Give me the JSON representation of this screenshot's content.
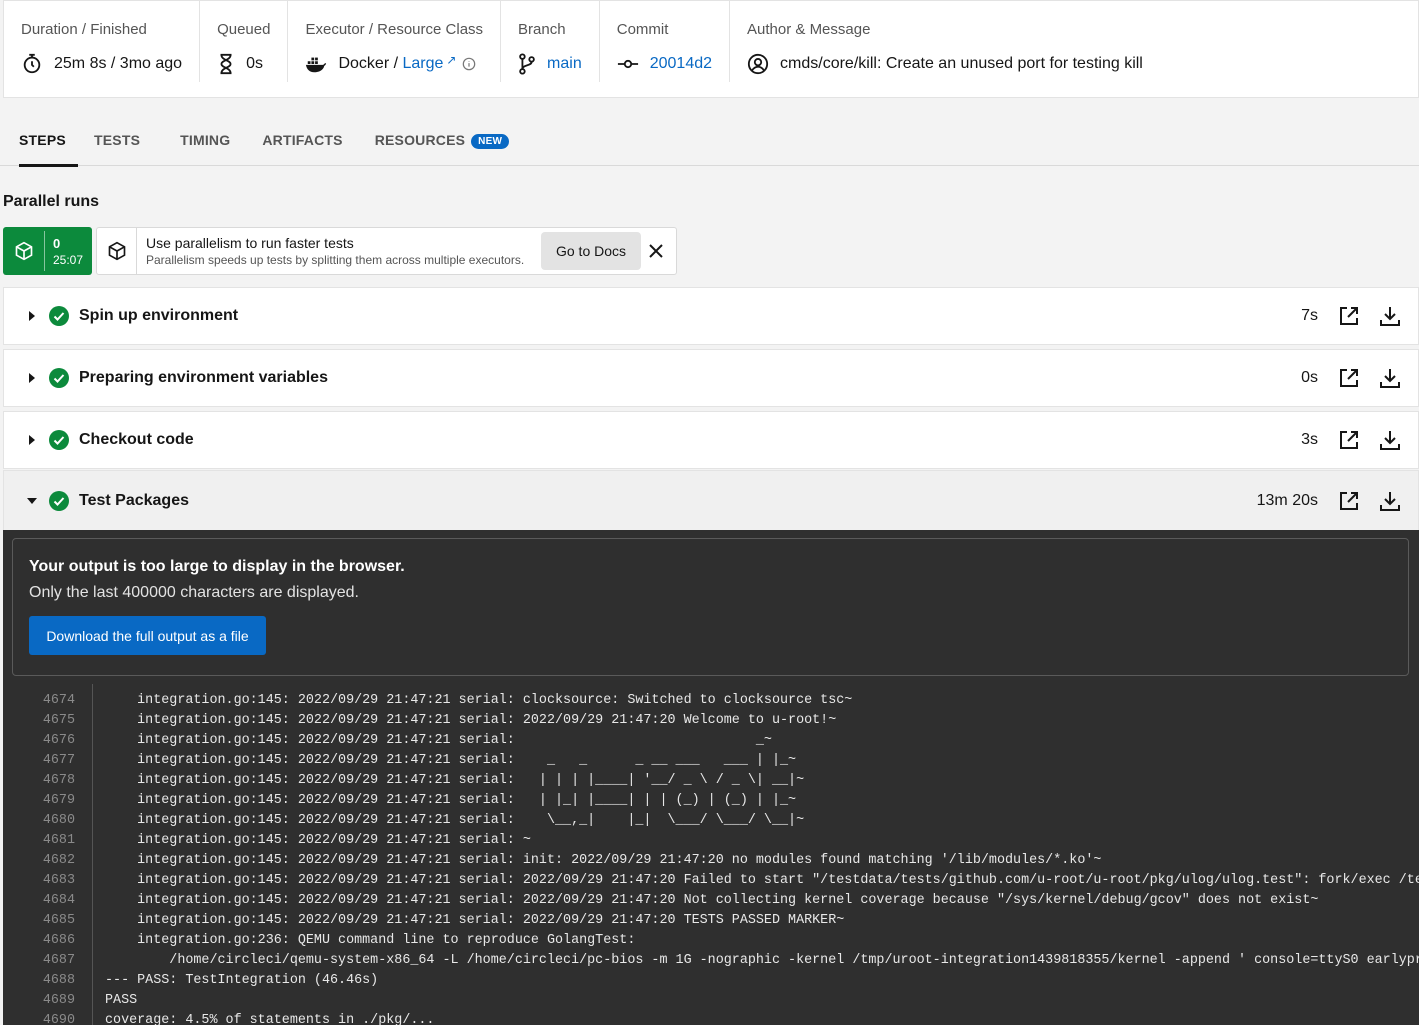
{
  "summary": {
    "duration": {
      "label": "Duration / Finished",
      "value": "25m 8s / 3mo ago"
    },
    "queued": {
      "label": "Queued",
      "value": "0s"
    },
    "executor": {
      "label": "Executor / Resource Class",
      "prefix": "Docker / ",
      "resource_class": "Large"
    },
    "branch": {
      "label": "Branch",
      "value": "main"
    },
    "commit": {
      "label": "Commit",
      "value": "20014d2"
    },
    "author": {
      "label": "Author & Message",
      "value": "cmds/core/kill: Create an unused port for testing kill"
    }
  },
  "tabs": [
    {
      "label": "STEPS",
      "active": true
    },
    {
      "label": "TESTS"
    },
    {
      "label": "TIMING"
    },
    {
      "label": "ARTIFACTS"
    },
    {
      "label": "RESOURCES",
      "badge": "NEW"
    }
  ],
  "parallel": {
    "title": "Parallel runs",
    "run_index": "0",
    "run_time": "25:07",
    "tip_title": "Use parallelism to run faster tests",
    "tip_sub": "Parallelism speeds up tests by splitting them across multiple executors.",
    "docs_label": "Go to Docs"
  },
  "steps": [
    {
      "name": "Spin up environment",
      "duration": "7s",
      "expanded": false
    },
    {
      "name": "Preparing environment variables",
      "duration": "0s",
      "expanded": false
    },
    {
      "name": "Checkout code",
      "duration": "3s",
      "expanded": false
    },
    {
      "name": "Test Packages",
      "duration": "13m 20s",
      "expanded": true
    }
  ],
  "output": {
    "warn_title": "Your output is too large to display in the browser.",
    "warn_sub": "Only the last 400000 characters are displayed.",
    "download_label": "Download the full output as a file",
    "lines": [
      {
        "n": "4674",
        "t": "    integration.go:145: 2022/09/29 21:47:21 serial: clocksource: Switched to clocksource tsc~"
      },
      {
        "n": "4675",
        "t": "    integration.go:145: 2022/09/29 21:47:21 serial: 2022/09/29 21:47:20 Welcome to u-root!~"
      },
      {
        "n": "4676",
        "t": "    integration.go:145: 2022/09/29 21:47:21 serial:                              _~"
      },
      {
        "n": "4677",
        "t": "    integration.go:145: 2022/09/29 21:47:21 serial:    _   _      _ __ ___   ___ | |_~"
      },
      {
        "n": "4678",
        "t": "    integration.go:145: 2022/09/29 21:47:21 serial:   | | | |____| '__/ _ \\ / _ \\| __|~"
      },
      {
        "n": "4679",
        "t": "    integration.go:145: 2022/09/29 21:47:21 serial:   | |_| |____| | | (_) | (_) | |_~"
      },
      {
        "n": "4680",
        "t": "    integration.go:145: 2022/09/29 21:47:21 serial:    \\__,_|    |_|  \\___/ \\___/ \\__|~"
      },
      {
        "n": "4681",
        "t": "    integration.go:145: 2022/09/29 21:47:21 serial: ~"
      },
      {
        "n": "4682",
        "t": "    integration.go:145: 2022/09/29 21:47:21 serial: init: 2022/09/29 21:47:20 no modules found matching '/lib/modules/*.ko'~"
      },
      {
        "n": "4683",
        "t": "    integration.go:145: 2022/09/29 21:47:21 serial: 2022/09/29 21:47:20 Failed to start \"/testdata/tests/github.com/u-root/u-root/pkg/ulog/ulog.test\": fork/exec /te"
      },
      {
        "n": "4684",
        "t": "    integration.go:145: 2022/09/29 21:47:21 serial: 2022/09/29 21:47:20 Not collecting kernel coverage because \"/sys/kernel/debug/gcov\" does not exist~"
      },
      {
        "n": "4685",
        "t": "    integration.go:145: 2022/09/29 21:47:21 serial: 2022/09/29 21:47:20 TESTS PASSED MARKER~"
      },
      {
        "n": "4686",
        "t": "    integration.go:236: QEMU command line to reproduce GolangTest:"
      },
      {
        "n": "4687",
        "t": "        /home/circleci/qemu-system-x86_64 -L /home/circleci/pc-bios -m 1G -nographic -kernel /tmp/uroot-integration1439818355/kernel -append ' console=ttyS0 earlypr"
      },
      {
        "n": "4688",
        "t": "--- PASS: TestIntegration (46.46s)"
      },
      {
        "n": "4689",
        "t": "PASS"
      },
      {
        "n": "4690",
        "t": "coverage: 4.5% of statements in ./pkg/..."
      }
    ]
  }
}
